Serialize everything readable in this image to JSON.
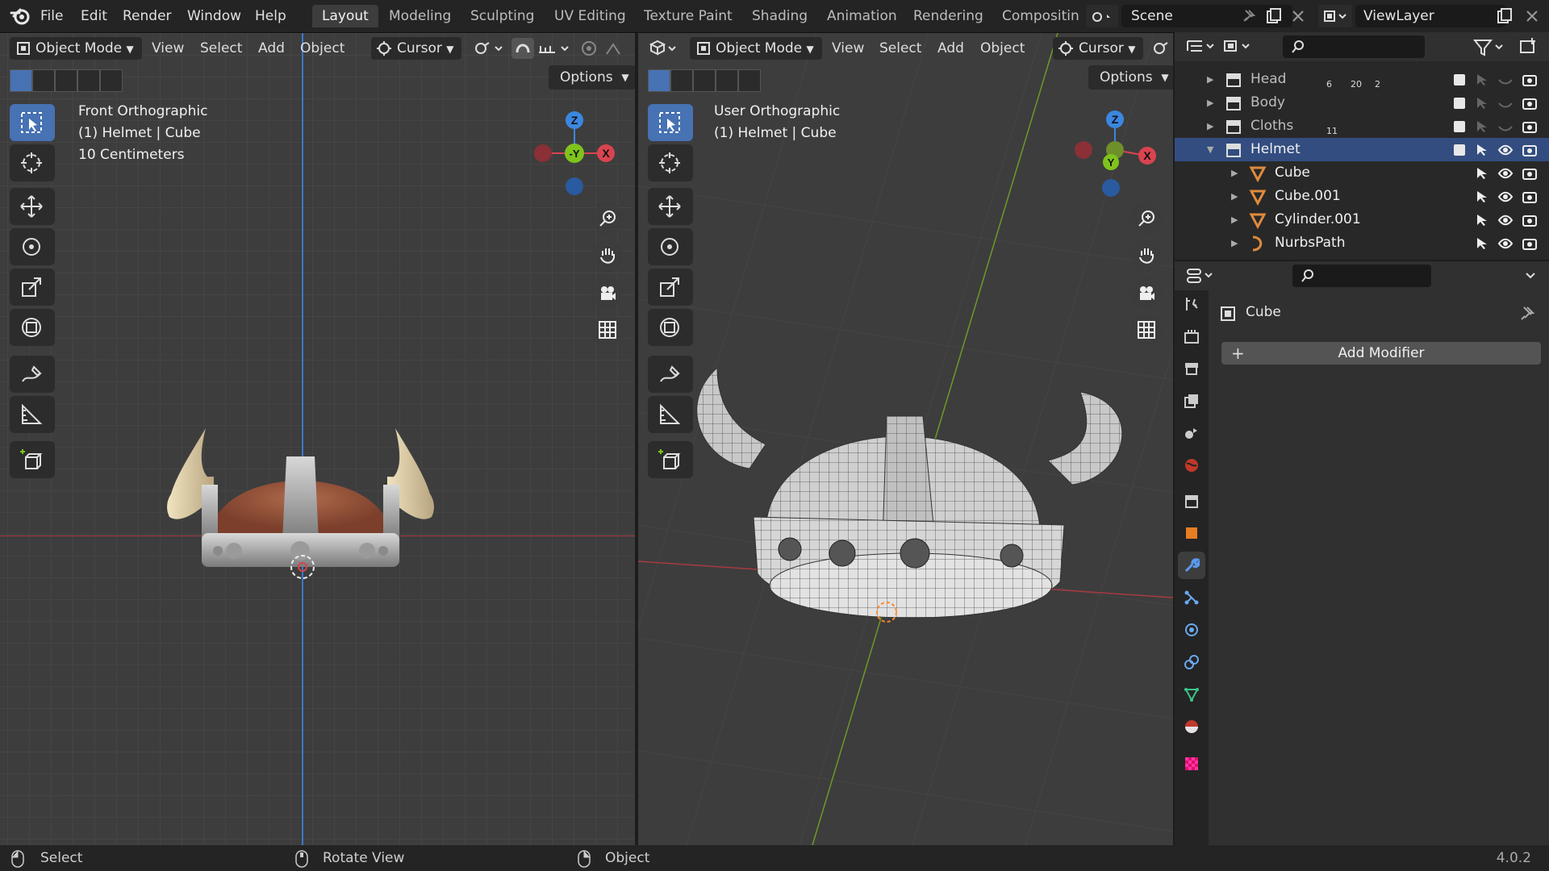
{
  "topbar": {
    "menus": [
      "File",
      "Edit",
      "Render",
      "Window",
      "Help"
    ],
    "workspaces": [
      {
        "label": "Layout",
        "active": true
      },
      {
        "label": "Modeling",
        "active": false
      },
      {
        "label": "Sculpting",
        "active": false
      },
      {
        "label": "UV Editing",
        "active": false
      },
      {
        "label": "Texture Paint",
        "active": false
      },
      {
        "label": "Shading",
        "active": false
      },
      {
        "label": "Animation",
        "active": false
      },
      {
        "label": "Rendering",
        "active": false
      },
      {
        "label": "Compositin",
        "active": false
      }
    ],
    "scene_label": "Scene",
    "viewlayer_label": "ViewLayer"
  },
  "viewport_left": {
    "mode": "Object Mode",
    "menus": [
      "View",
      "Select",
      "Add",
      "Object"
    ],
    "pivot": "Cursor",
    "options": "Options",
    "overlay": [
      "Front Orthographic",
      "(1) Helmet | Cube",
      "10 Centimeters"
    ],
    "gizmo": {
      "z": "Z",
      "y": "-Y",
      "x": "X"
    }
  },
  "viewport_right": {
    "mode": "Object Mode",
    "menus": [
      "View",
      "Select",
      "Add",
      "Object"
    ],
    "pivot": "Cursor",
    "options": "Options",
    "overlay": [
      "User Orthographic",
      "(1) Helmet | Cube"
    ],
    "gizmo": {
      "z": "Z",
      "y": "Y",
      "x": "X"
    }
  },
  "outliner": {
    "rows": [
      {
        "label": "Head",
        "indent": 0,
        "type": "collection",
        "badges": [
          "6",
          "20",
          "2"
        ],
        "selected": false
      },
      {
        "label": "Body",
        "indent": 0,
        "type": "collection",
        "badges": [],
        "selected": false
      },
      {
        "label": "Cloths",
        "indent": 0,
        "type": "collection",
        "badges": [
          "11"
        ],
        "selected": false
      },
      {
        "label": "Helmet",
        "indent": 0,
        "type": "collection",
        "badges": [],
        "selected": true,
        "expanded": true
      },
      {
        "label": "Cube",
        "indent": 1,
        "type": "mesh",
        "badges": [],
        "selected": false
      },
      {
        "label": "Cube.001",
        "indent": 1,
        "type": "mesh",
        "badges": [],
        "selected": false
      },
      {
        "label": "Cylinder.001",
        "indent": 1,
        "type": "mesh",
        "badges": [],
        "selected": false
      },
      {
        "label": "NurbsPath",
        "indent": 1,
        "type": "curve",
        "badges": [],
        "selected": false
      }
    ]
  },
  "properties": {
    "object_name": "Cube",
    "add_modifier": "Add Modifier"
  },
  "statusbar": {
    "select": "Select",
    "rotate": "Rotate View",
    "object": "Object",
    "version": "4.0.2"
  },
  "colors": {
    "accent": "#4772b3",
    "x_axis": "#d8444f",
    "y_axis": "#7fc31c",
    "z_axis": "#3b87e0",
    "selected_row": "#334d80"
  }
}
